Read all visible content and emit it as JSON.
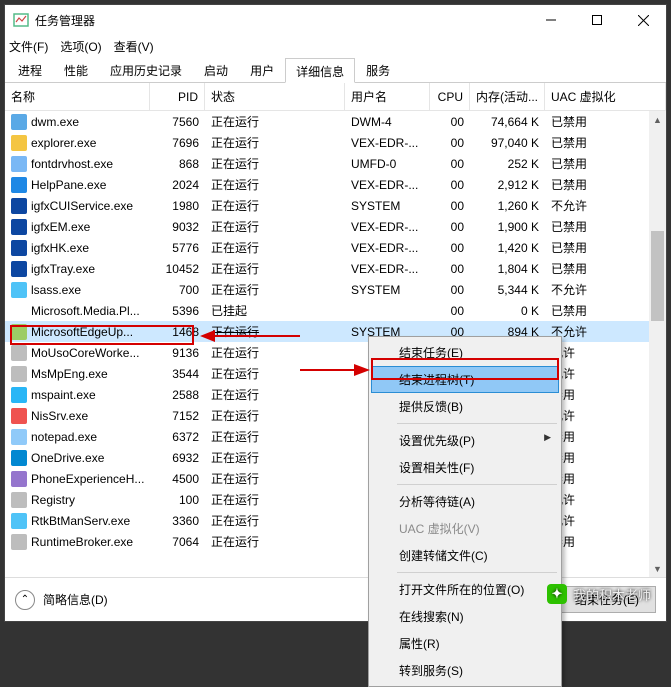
{
  "window": {
    "title": "任务管理器"
  },
  "menu": {
    "file": "文件(F)",
    "options": "选项(O)",
    "view": "查看(V)"
  },
  "tabs": [
    "进程",
    "性能",
    "应用历史记录",
    "启动",
    "用户",
    "详细信息",
    "服务"
  ],
  "active_tab_index": 5,
  "columns": {
    "name": "名称",
    "pid": "PID",
    "status": "状态",
    "user": "用户名",
    "cpu": "CPU",
    "mem": "内存(活动...",
    "uac": "UAC 虚拟化"
  },
  "rows": [
    {
      "name": "dwm.exe",
      "pid": "7560",
      "status": "正在运行",
      "user": "DWM-4",
      "cpu": "00",
      "mem": "74,664 K",
      "uac": "已禁用",
      "color": "#5aa9e6"
    },
    {
      "name": "explorer.exe",
      "pid": "7696",
      "status": "正在运行",
      "user": "VEX-EDR-...",
      "cpu": "00",
      "mem": "97,040 K",
      "uac": "已禁用",
      "color": "#f4c542"
    },
    {
      "name": "fontdrvhost.exe",
      "pid": "868",
      "status": "正在运行",
      "user": "UMFD-0",
      "cpu": "00",
      "mem": "252 K",
      "uac": "已禁用",
      "color": "#7ab8f5"
    },
    {
      "name": "HelpPane.exe",
      "pid": "2024",
      "status": "正在运行",
      "user": "VEX-EDR-...",
      "cpu": "00",
      "mem": "2,912 K",
      "uac": "已禁用",
      "color": "#1e88e5"
    },
    {
      "name": "igfxCUIService.exe",
      "pid": "1980",
      "status": "正在运行",
      "user": "SYSTEM",
      "cpu": "00",
      "mem": "1,260 K",
      "uac": "不允许",
      "color": "#0d47a1"
    },
    {
      "name": "igfxEM.exe",
      "pid": "9032",
      "status": "正在运行",
      "user": "VEX-EDR-...",
      "cpu": "00",
      "mem": "1,900 K",
      "uac": "已禁用",
      "color": "#0d47a1"
    },
    {
      "name": "igfxHK.exe",
      "pid": "5776",
      "status": "正在运行",
      "user": "VEX-EDR-...",
      "cpu": "00",
      "mem": "1,420 K",
      "uac": "已禁用",
      "color": "#0d47a1"
    },
    {
      "name": "igfxTray.exe",
      "pid": "10452",
      "status": "正在运行",
      "user": "VEX-EDR-...",
      "cpu": "00",
      "mem": "1,804 K",
      "uac": "已禁用",
      "color": "#0d47a1"
    },
    {
      "name": "lsass.exe",
      "pid": "700",
      "status": "正在运行",
      "user": "SYSTEM",
      "cpu": "00",
      "mem": "5,344 K",
      "uac": "不允许",
      "color": "#4fc3f7"
    },
    {
      "name": "Microsoft.Media.Pl...",
      "pid": "5396",
      "status": "已挂起",
      "user": "",
      "cpu": "00",
      "mem": "0 K",
      "uac": "已禁用",
      "color": "#ffffff"
    },
    {
      "name": "MicrosoftEdgeUp...",
      "pid": "1468",
      "status": "正在运行",
      "user": "SYSTEM",
      "cpu": "00",
      "mem": "894 K",
      "uac": "不允许",
      "color": "#9ccc65",
      "selected": true
    },
    {
      "name": "MoUsoCoreWorke...",
      "pid": "9136",
      "status": "正在运行",
      "user": "",
      "cpu": "",
      "mem": "",
      "uac": "允许",
      "color": "#bdbdbd"
    },
    {
      "name": "MsMpEng.exe",
      "pid": "3544",
      "status": "正在运行",
      "user": "",
      "cpu": "",
      "mem": "",
      "uac": "允许",
      "color": "#bdbdbd"
    },
    {
      "name": "mspaint.exe",
      "pid": "2588",
      "status": "正在运行",
      "user": "",
      "cpu": "",
      "mem": "",
      "uac": "禁用",
      "color": "#29b6f6"
    },
    {
      "name": "NisSrv.exe",
      "pid": "7152",
      "status": "正在运行",
      "user": "",
      "cpu": "",
      "mem": "",
      "uac": "允许",
      "color": "#ef5350"
    },
    {
      "name": "notepad.exe",
      "pid": "6372",
      "status": "正在运行",
      "user": "",
      "cpu": "",
      "mem": "",
      "uac": "禁用",
      "color": "#90caf9"
    },
    {
      "name": "OneDrive.exe",
      "pid": "6932",
      "status": "正在运行",
      "user": "",
      "cpu": "",
      "mem": "",
      "uac": "禁用",
      "color": "#0288d1"
    },
    {
      "name": "PhoneExperienceH...",
      "pid": "4500",
      "status": "正在运行",
      "user": "",
      "cpu": "",
      "mem": "",
      "uac": "禁用",
      "color": "#9575cd"
    },
    {
      "name": "Registry",
      "pid": "100",
      "status": "正在运行",
      "user": "",
      "cpu": "",
      "mem": "",
      "uac": "允许",
      "color": "#bdbdbd"
    },
    {
      "name": "RtkBtManServ.exe",
      "pid": "3360",
      "status": "正在运行",
      "user": "",
      "cpu": "",
      "mem": "",
      "uac": "允许",
      "color": "#4fc3f7"
    },
    {
      "name": "RuntimeBroker.exe",
      "pid": "7064",
      "status": "正在运行",
      "user": "",
      "cpu": "",
      "mem": "",
      "uac": "禁用",
      "color": "#bdbdbd"
    }
  ],
  "context_menu": {
    "items": [
      {
        "label": "结束任务(E)"
      },
      {
        "label": "结束进程树(T)",
        "highlight": true
      },
      {
        "label": "提供反馈(B)"
      },
      {
        "sep": true
      },
      {
        "label": "设置优先级(P)",
        "sub": true
      },
      {
        "label": "设置相关性(F)"
      },
      {
        "sep": true
      },
      {
        "label": "分析等待链(A)"
      },
      {
        "label": "UAC 虚拟化(V)",
        "disabled": true
      },
      {
        "label": "创建转储文件(C)"
      },
      {
        "sep": true
      },
      {
        "label": "打开文件所在的位置(O)"
      },
      {
        "label": "在线搜索(N)"
      },
      {
        "label": "属性(R)"
      },
      {
        "label": "转到服务(S)"
      }
    ]
  },
  "footer": {
    "simple": "简略信息(D)",
    "end": "结束任务(E)"
  },
  "watermark": "我的积木老师"
}
